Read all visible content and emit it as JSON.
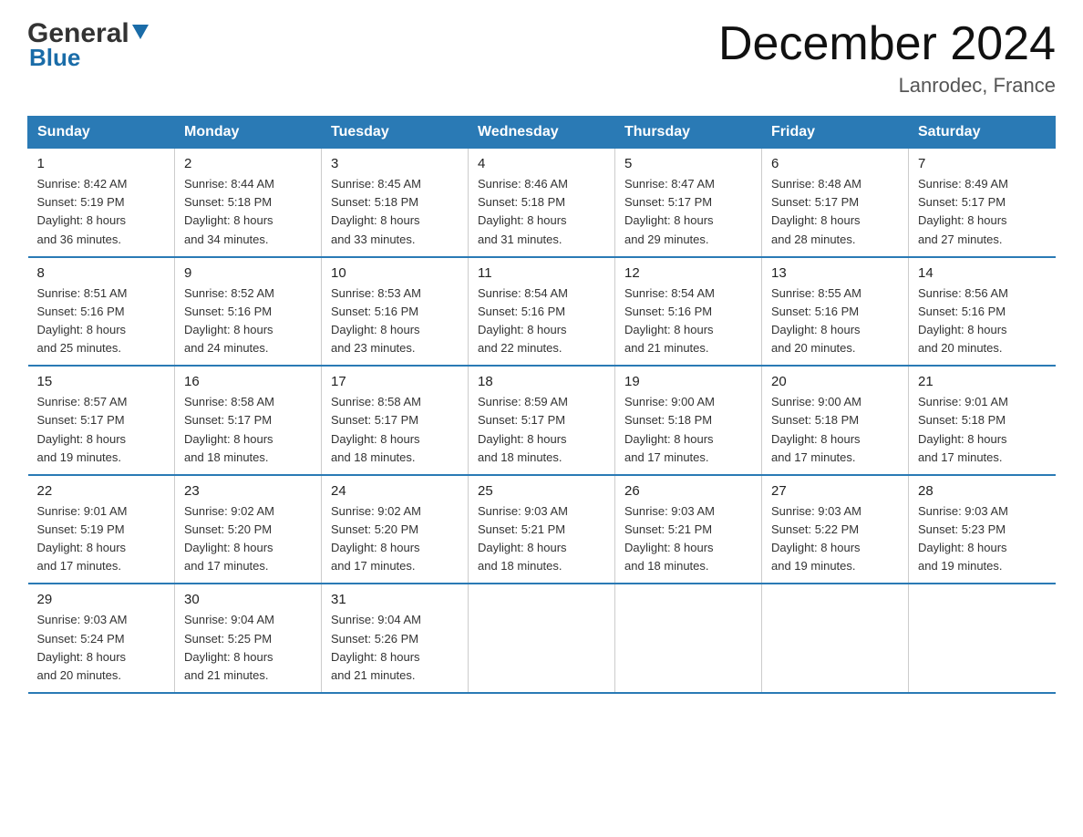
{
  "header": {
    "logo_general": "General",
    "logo_blue": "Blue",
    "month_title": "December 2024",
    "location": "Lanrodec, France"
  },
  "days_of_week": [
    "Sunday",
    "Monday",
    "Tuesday",
    "Wednesday",
    "Thursday",
    "Friday",
    "Saturday"
  ],
  "weeks": [
    [
      {
        "day": "1",
        "sunrise": "8:42 AM",
        "sunset": "5:19 PM",
        "daylight": "8 hours and 36 minutes."
      },
      {
        "day": "2",
        "sunrise": "8:44 AM",
        "sunset": "5:18 PM",
        "daylight": "8 hours and 34 minutes."
      },
      {
        "day": "3",
        "sunrise": "8:45 AM",
        "sunset": "5:18 PM",
        "daylight": "8 hours and 33 minutes."
      },
      {
        "day": "4",
        "sunrise": "8:46 AM",
        "sunset": "5:18 PM",
        "daylight": "8 hours and 31 minutes."
      },
      {
        "day": "5",
        "sunrise": "8:47 AM",
        "sunset": "5:17 PM",
        "daylight": "8 hours and 29 minutes."
      },
      {
        "day": "6",
        "sunrise": "8:48 AM",
        "sunset": "5:17 PM",
        "daylight": "8 hours and 28 minutes."
      },
      {
        "day": "7",
        "sunrise": "8:49 AM",
        "sunset": "5:17 PM",
        "daylight": "8 hours and 27 minutes."
      }
    ],
    [
      {
        "day": "8",
        "sunrise": "8:51 AM",
        "sunset": "5:16 PM",
        "daylight": "8 hours and 25 minutes."
      },
      {
        "day": "9",
        "sunrise": "8:52 AM",
        "sunset": "5:16 PM",
        "daylight": "8 hours and 24 minutes."
      },
      {
        "day": "10",
        "sunrise": "8:53 AM",
        "sunset": "5:16 PM",
        "daylight": "8 hours and 23 minutes."
      },
      {
        "day": "11",
        "sunrise": "8:54 AM",
        "sunset": "5:16 PM",
        "daylight": "8 hours and 22 minutes."
      },
      {
        "day": "12",
        "sunrise": "8:54 AM",
        "sunset": "5:16 PM",
        "daylight": "8 hours and 21 minutes."
      },
      {
        "day": "13",
        "sunrise": "8:55 AM",
        "sunset": "5:16 PM",
        "daylight": "8 hours and 20 minutes."
      },
      {
        "day": "14",
        "sunrise": "8:56 AM",
        "sunset": "5:16 PM",
        "daylight": "8 hours and 20 minutes."
      }
    ],
    [
      {
        "day": "15",
        "sunrise": "8:57 AM",
        "sunset": "5:17 PM",
        "daylight": "8 hours and 19 minutes."
      },
      {
        "day": "16",
        "sunrise": "8:58 AM",
        "sunset": "5:17 PM",
        "daylight": "8 hours and 18 minutes."
      },
      {
        "day": "17",
        "sunrise": "8:58 AM",
        "sunset": "5:17 PM",
        "daylight": "8 hours and 18 minutes."
      },
      {
        "day": "18",
        "sunrise": "8:59 AM",
        "sunset": "5:17 PM",
        "daylight": "8 hours and 18 minutes."
      },
      {
        "day": "19",
        "sunrise": "9:00 AM",
        "sunset": "5:18 PM",
        "daylight": "8 hours and 17 minutes."
      },
      {
        "day": "20",
        "sunrise": "9:00 AM",
        "sunset": "5:18 PM",
        "daylight": "8 hours and 17 minutes."
      },
      {
        "day": "21",
        "sunrise": "9:01 AM",
        "sunset": "5:18 PM",
        "daylight": "8 hours and 17 minutes."
      }
    ],
    [
      {
        "day": "22",
        "sunrise": "9:01 AM",
        "sunset": "5:19 PM",
        "daylight": "8 hours and 17 minutes."
      },
      {
        "day": "23",
        "sunrise": "9:02 AM",
        "sunset": "5:20 PM",
        "daylight": "8 hours and 17 minutes."
      },
      {
        "day": "24",
        "sunrise": "9:02 AM",
        "sunset": "5:20 PM",
        "daylight": "8 hours and 17 minutes."
      },
      {
        "day": "25",
        "sunrise": "9:03 AM",
        "sunset": "5:21 PM",
        "daylight": "8 hours and 18 minutes."
      },
      {
        "day": "26",
        "sunrise": "9:03 AM",
        "sunset": "5:21 PM",
        "daylight": "8 hours and 18 minutes."
      },
      {
        "day": "27",
        "sunrise": "9:03 AM",
        "sunset": "5:22 PM",
        "daylight": "8 hours and 19 minutes."
      },
      {
        "day": "28",
        "sunrise": "9:03 AM",
        "sunset": "5:23 PM",
        "daylight": "8 hours and 19 minutes."
      }
    ],
    [
      {
        "day": "29",
        "sunrise": "9:03 AM",
        "sunset": "5:24 PM",
        "daylight": "8 hours and 20 minutes."
      },
      {
        "day": "30",
        "sunrise": "9:04 AM",
        "sunset": "5:25 PM",
        "daylight": "8 hours and 21 minutes."
      },
      {
        "day": "31",
        "sunrise": "9:04 AM",
        "sunset": "5:26 PM",
        "daylight": "8 hours and 21 minutes."
      },
      null,
      null,
      null,
      null
    ]
  ],
  "labels": {
    "sunrise": "Sunrise:",
    "sunset": "Sunset:",
    "daylight": "Daylight:"
  }
}
